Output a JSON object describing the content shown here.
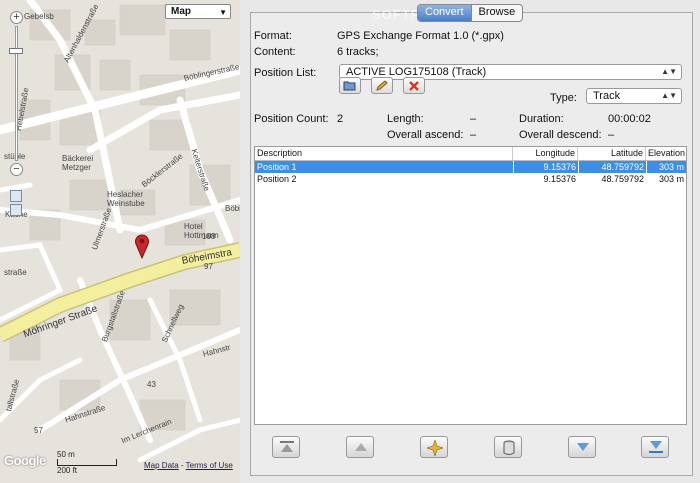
{
  "watermark": "SOFTPEDIA",
  "map": {
    "type_selected": "Map",
    "scale_metric": "50 m",
    "scale_imperial": "200 ft",
    "logo": "Google",
    "footer_data": "Map Data",
    "footer_sep": " - ",
    "footer_terms": "Terms of Use",
    "streets": {
      "boheimstr": "Böheimstra",
      "mohringer": "Möhringer Straße",
      "boblinger": "Böblingerstraße",
      "bocklerstr": "Böcklerstraße",
      "kelterstr": "Kelterstraße",
      "uhlandstr": "Ulmerstraße",
      "burgstall": "Burgstallstraße",
      "schnellweg": "Schnellweg",
      "hahnstr": "Hahnstraße",
      "hahnstr2": "Hahnstr",
      "lerchenrain": "Im Lerchenrain",
      "aeltinger": "Altenhaldenstraße",
      "gebelsb": "Gebelsb",
      "hebel": "Hebelstraße",
      "kaeche": "Käche",
      "stueble": "stüble",
      "baeckerei": "Bäckerei Metzger",
      "heslacher": "Heslacher Weinstube",
      "hotel": "Hotel Hottmann",
      "burgstall2": "Burgstall",
      "boebl": "Böbl",
      "boeh": "Böh",
      "strasse": "straße",
      "tallstr": "tallstraße",
      "num97": "97",
      "num43": "43",
      "num57": "57",
      "num108": "108"
    }
  },
  "tabs": {
    "convert": "Convert",
    "browse": "Browse"
  },
  "info": {
    "format_label": "Format:",
    "format_value": "GPS Exchange Format 1.0 (*.gpx)",
    "content_label": "Content:",
    "content_value": "6 tracks;",
    "position_list_label": "Position List:",
    "position_list_value": "ACTIVE LOG175108 (Track)",
    "type_label": "Type:",
    "type_value": "Track",
    "count_label": "Position Count:",
    "count_value": "2",
    "length_label": "Length:",
    "length_value": "–",
    "duration_label": "Duration:",
    "duration_value": "00:00:02",
    "ascend_label": "Overall ascend:",
    "ascend_value": "–",
    "descend_label": "Overall descend:",
    "descend_value": "–"
  },
  "table": {
    "columns": [
      "Description",
      "Longitude",
      "Latitude",
      "Elevation"
    ],
    "rows": [
      {
        "description": "Position 1",
        "longitude": "9.15376",
        "latitude": "48.759792",
        "elevation": "303 m",
        "selected": true
      },
      {
        "description": "Position 2",
        "longitude": "9.15376",
        "latitude": "48.759792",
        "elevation": "303 m",
        "selected": false
      }
    ]
  },
  "colors": {
    "selection": "#3c8ee6",
    "marker": "#c8262a",
    "major_road": "#f4ef9e"
  }
}
